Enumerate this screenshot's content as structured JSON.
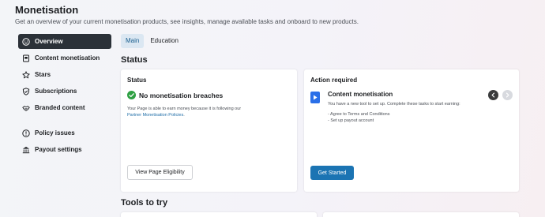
{
  "header": {
    "title": "Monetisation",
    "subtitle": "Get an overview of your current monetisation products, see insights, manage available tasks and onboard to new products."
  },
  "sidebar": {
    "items": [
      {
        "label": "Overview",
        "icon": "smiley-icon"
      },
      {
        "label": "Content monetisation",
        "icon": "content-icon"
      },
      {
        "label": "Stars",
        "icon": "star-icon"
      },
      {
        "label": "Subscriptions",
        "icon": "shield-icon"
      },
      {
        "label": "Branded content",
        "icon": "handshake-icon"
      }
    ],
    "secondary_items": [
      {
        "label": "Policy issues",
        "icon": "alert-icon"
      },
      {
        "label": "Payout settings",
        "icon": "bank-icon"
      }
    ]
  },
  "tabs": [
    {
      "label": "Main"
    },
    {
      "label": "Education"
    }
  ],
  "status_section": {
    "heading": "Status",
    "card": {
      "title": "Status",
      "check_label": "No monetisation breaches",
      "body_line1": "Your Page is able to earn money because it is following our",
      "link": "Partner Monetisation Policies",
      "link_suffix": ".",
      "button": "View Page Eligibility"
    }
  },
  "action_card": {
    "title": "Action required",
    "name": "Content monetisation",
    "description": "You have a new tool to set up. Complete these tasks to start earning:",
    "tasks": [
      "- Agree to Terms and Conditions",
      "- Set up payout account"
    ],
    "button": "Get Started"
  },
  "tools": {
    "heading": "Tools to try"
  },
  "colors": {
    "active_nav": "#2b3138",
    "primary_button": "#1b74b3",
    "success": "#2ea043",
    "link": "#216fa8"
  }
}
